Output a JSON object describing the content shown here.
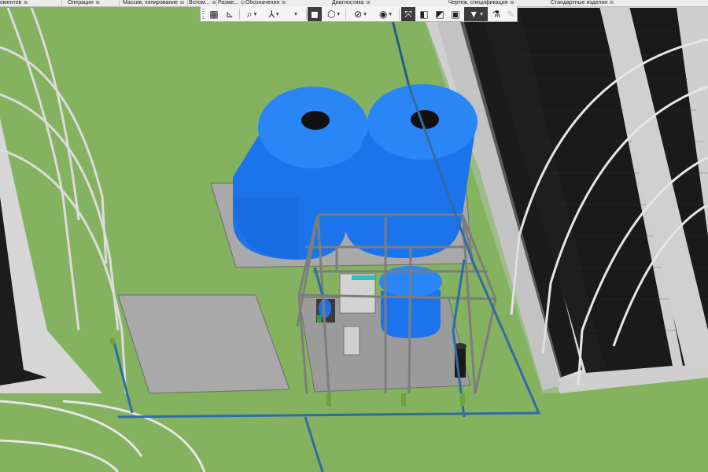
{
  "panels": [
    {
      "id": "components",
      "label": "оментов"
    },
    {
      "id": "operations",
      "label": "Операции"
    },
    {
      "id": "array-copy",
      "label": "Массив, копирование"
    },
    {
      "id": "auxiliary",
      "label": "Вспом..."
    },
    {
      "id": "dimensions",
      "label": "Разме..."
    },
    {
      "id": "designations",
      "label": "Обозначения"
    },
    {
      "id": "diagnostics",
      "label": "Диагностика"
    },
    {
      "id": "drawing-spec",
      "label": "Чертеж, спецификация"
    },
    {
      "id": "standard-parts",
      "label": "Стандартные изделия"
    }
  ],
  "panel_pin_glyph": "⊞",
  "toolbar": {
    "tools": [
      {
        "id": "grid",
        "icon": "grid-icon",
        "glyph": "▦"
      },
      {
        "id": "lcs",
        "icon": "local-coordinate-system-icon",
        "glyph": "⊾"
      },
      {
        "id": "zoom",
        "icon": "zoom-icon",
        "glyph": "⌕"
      },
      {
        "id": "orient",
        "icon": "orientation-icon",
        "glyph": "⅄"
      },
      {
        "id": "shaded",
        "icon": "shaded-view-icon",
        "glyph": "◼",
        "pressed": true
      },
      {
        "id": "wire",
        "icon": "wireframe-view-icon",
        "glyph": "⬡"
      },
      {
        "id": "hide",
        "icon": "hide-objects-icon",
        "glyph": "⊘"
      },
      {
        "id": "visibility",
        "icon": "visibility-icon",
        "glyph": "◉"
      },
      {
        "id": "perspective",
        "icon": "perspective-icon",
        "glyph": "⤧",
        "pressed": true
      },
      {
        "id": "section",
        "icon": "section-icon",
        "glyph": "◧"
      },
      {
        "id": "simplify",
        "icon": "simplified-display-icon",
        "glyph": "◩"
      },
      {
        "id": "filter",
        "icon": "filter-icon",
        "glyph": "▼",
        "pressed": true
      },
      {
        "id": "measure",
        "icon": "measure-icon",
        "glyph": "⚗"
      },
      {
        "id": "pencil",
        "icon": "pencil-icon",
        "glyph": "✎"
      }
    ]
  },
  "scene": {
    "colors": {
      "ground": "#84b25f",
      "tank_blue": "#1e7cf2",
      "tank_shadow": "#0f5fd2",
      "pad_gray": "#a9a9a9",
      "pipe": "#2a5a8a",
      "frame": "#7d7d7d",
      "panel_dark": "#1c1c1c",
      "greenhouse_frame": "#d7d7d7"
    }
  }
}
